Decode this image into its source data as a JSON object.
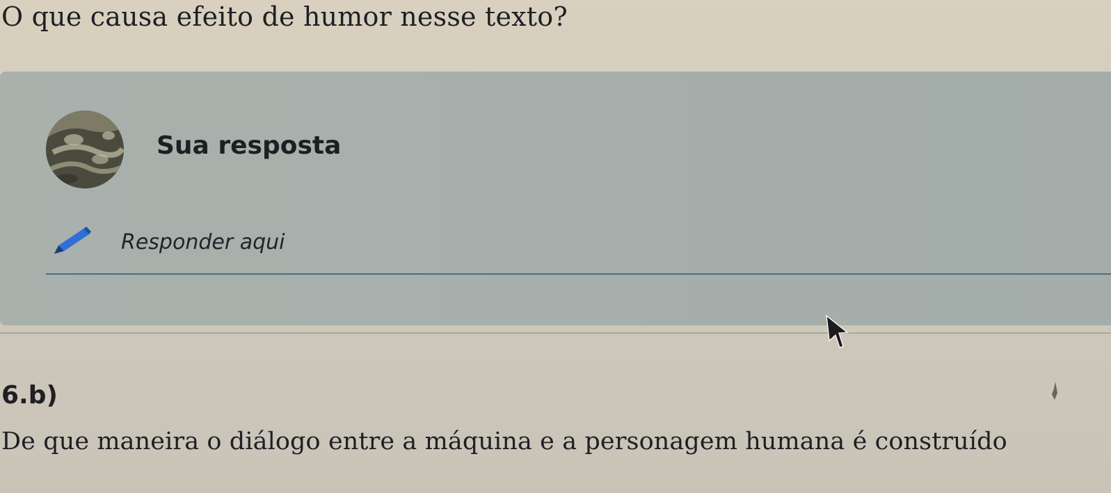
{
  "question": {
    "text": "O que causa efeito de humor nesse texto?"
  },
  "answer_panel": {
    "heading": "Sua resposta",
    "avatar_icon": "user-avatar",
    "field": {
      "icon": "pencil-icon",
      "placeholder": "Responder aqui"
    },
    "colors": {
      "panel": "#a8b0ac",
      "underline": "#4f6a86",
      "pencil": "#2f6fd6"
    }
  },
  "next_question": {
    "number": "6.b)",
    "text": "De que maneira o diálogo entre a máquina e a personagem humana é construído"
  },
  "pointer": {
    "icon": "mouse-cursor-icon"
  }
}
